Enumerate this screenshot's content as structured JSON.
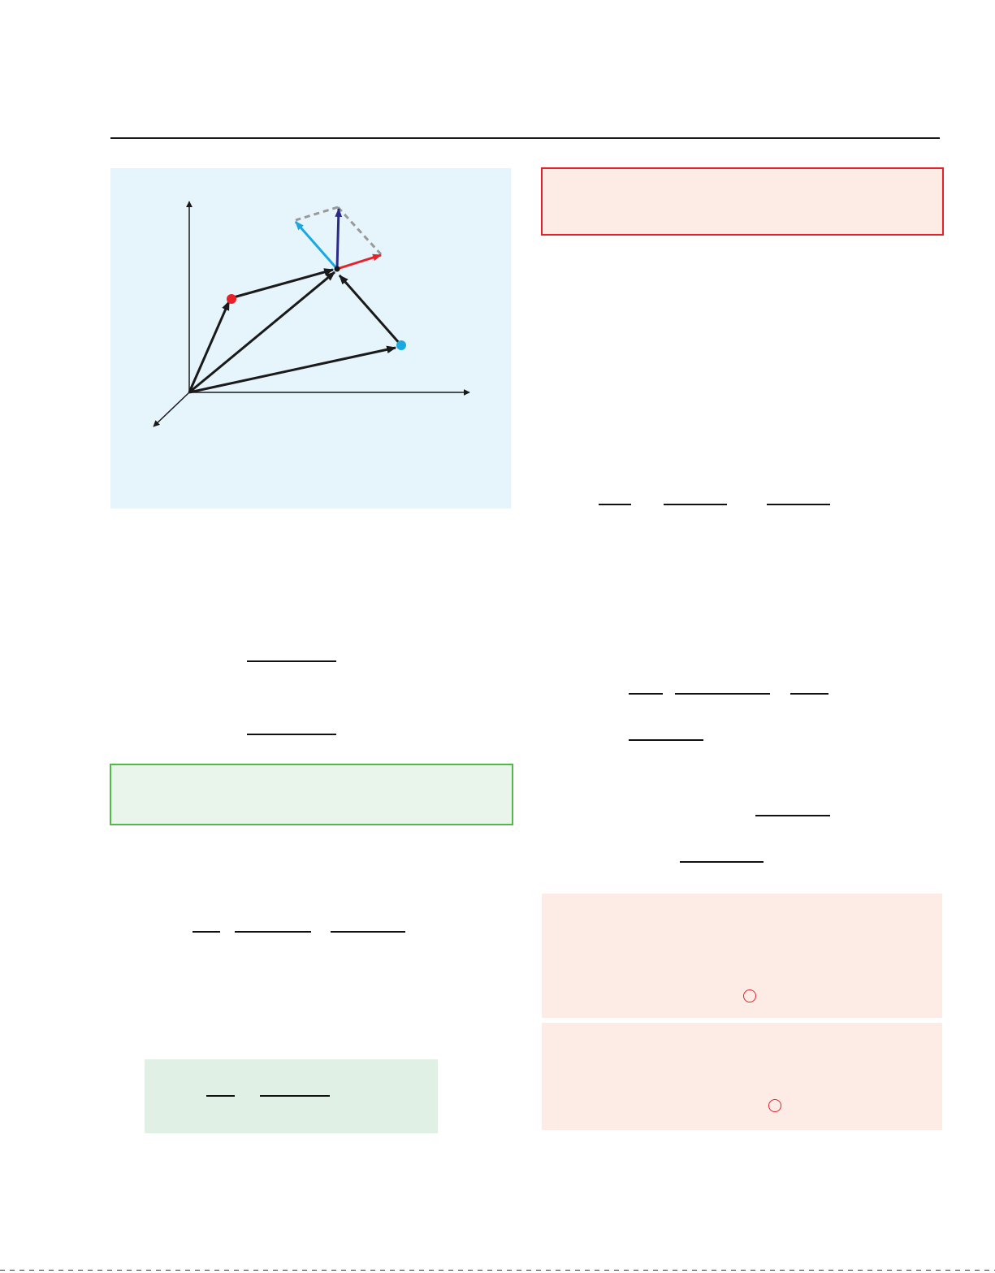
{
  "page": {
    "page_rule": "top-horizontal-rule",
    "figure_background": "#e6f4fc"
  },
  "figure": {
    "label_text": "",
    "colors": {
      "axes": "#1a1a1a",
      "black_vectors": "#1a1a1a",
      "red_point": "#e8202a",
      "cyan_point": "#1aa8e0",
      "red_vector": "#e8202a",
      "cyan_vector": "#1aa8e0",
      "blue_vector": "#2b2a8c",
      "dashed_lines": "#999999"
    }
  },
  "boxes": {
    "red_box": {
      "fill": "#fdece6",
      "border": "#e8202a",
      "text": ""
    },
    "green_box": {
      "fill": "#e9f4ea",
      "border": "#52b948",
      "text": ""
    },
    "green_result_box": {
      "fill": "#e1f0e4",
      "text": ""
    },
    "pink_box_1": {
      "fill": "#fdece6",
      "text": ""
    },
    "pink_box_2": {
      "fill": "#fdece6",
      "text": ""
    }
  },
  "marks": {
    "circle_color": "#e8202a"
  }
}
